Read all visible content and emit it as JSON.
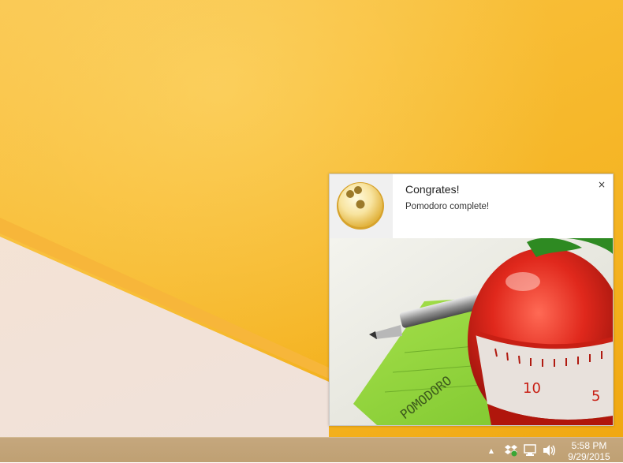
{
  "notification": {
    "title": "Congrates!",
    "message": "Pomodoro complete!",
    "close_label": "×",
    "image_labels": {
      "paper_text": "POMODORO",
      "dial_10": "10",
      "dial_5": "5"
    }
  },
  "tray": {
    "icons": [
      "show-hidden-icons-arrow-icon",
      "dropbox-icon",
      "network-icon",
      "volume-icon"
    ],
    "show_hidden_glyph": "▲"
  },
  "clock": {
    "time": "5:58 PM",
    "date": "9/29/2015"
  },
  "colors": {
    "wallpaper": "#f8bd35",
    "taskbar": "#c5a77d",
    "tomato_red": "#d8261b",
    "paper_green": "#8bd13b"
  }
}
